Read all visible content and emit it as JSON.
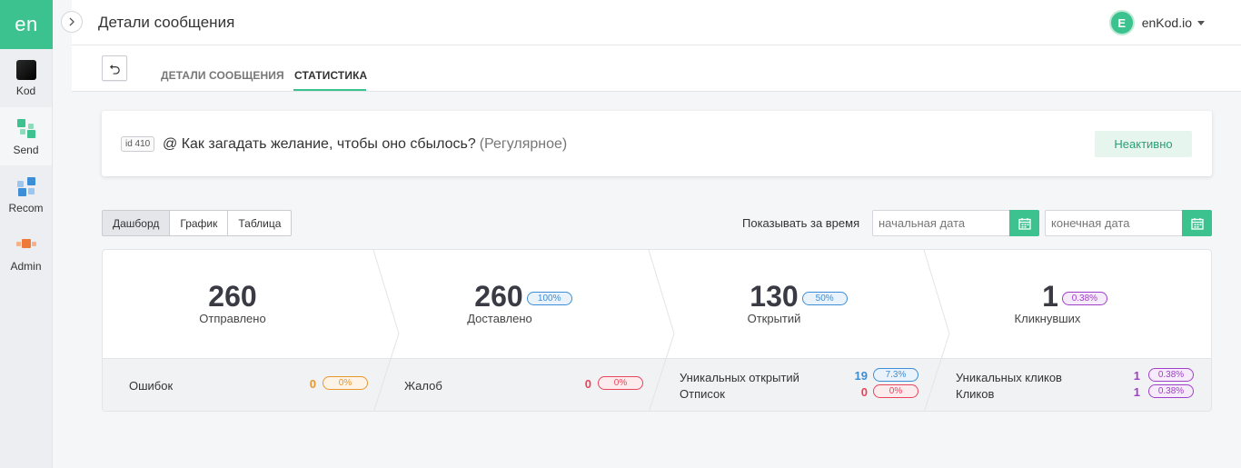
{
  "sidebar": {
    "logo": "en",
    "items": [
      {
        "label": "Kod"
      },
      {
        "label": "Send"
      },
      {
        "label": "Recom"
      },
      {
        "label": "Admin"
      }
    ]
  },
  "header": {
    "title": "Детали сообщения",
    "user": {
      "avatar_letter": "E",
      "name": "enKod.io"
    }
  },
  "tabs": [
    {
      "label": "ДЕТАЛИ СООБЩЕНИЯ",
      "active": false
    },
    {
      "label": "СТАТИСТИКА",
      "active": true
    }
  ],
  "message": {
    "id_badge": "id 410",
    "title": "@ Как загадать желание, чтобы оно сбылось?",
    "type": "(Регулярное)",
    "status": "Неактивно"
  },
  "toolbar": {
    "views": [
      "Дашборд",
      "График",
      "Таблица"
    ],
    "active_view": "Дашборд",
    "period_label": "Показывать за время",
    "start_date_placeholder": "начальная дата",
    "end_date_placeholder": "конечная дата"
  },
  "stats": {
    "sent": {
      "value": "260",
      "label": "Отправлено"
    },
    "delivered": {
      "value": "260",
      "percent": "100%",
      "label": "Доставлено"
    },
    "opened": {
      "value": "130",
      "percent": "50%",
      "label": "Открытий"
    },
    "clicked": {
      "value": "1",
      "percent": "0.38%",
      "label": "Кликнувших"
    },
    "errors": {
      "label": "Ошибок",
      "value": "0",
      "percent": "0%"
    },
    "complaints": {
      "label": "Жалоб",
      "value": "0",
      "percent": "0%"
    },
    "unique_opens": {
      "label": "Уникальных открытий",
      "value": "19",
      "percent": "7.3%"
    },
    "unsubscribes": {
      "label": "Отписок",
      "value": "0",
      "percent": "0%"
    },
    "unique_clicks": {
      "label": "Уникальных кликов",
      "value": "1",
      "percent": "0.38%"
    },
    "clicks": {
      "label": "Кликов",
      "value": "1",
      "percent": "0.38%"
    }
  },
  "colors": {
    "accent": "#3cc28f",
    "blue": "#3d8ed6",
    "purple": "#a040c8",
    "orange": "#e8962e",
    "red": "#e8445c"
  },
  "icons": [
    "chevron-right-icon",
    "undo-icon",
    "calendar-icon",
    "caret-down-icon"
  ]
}
